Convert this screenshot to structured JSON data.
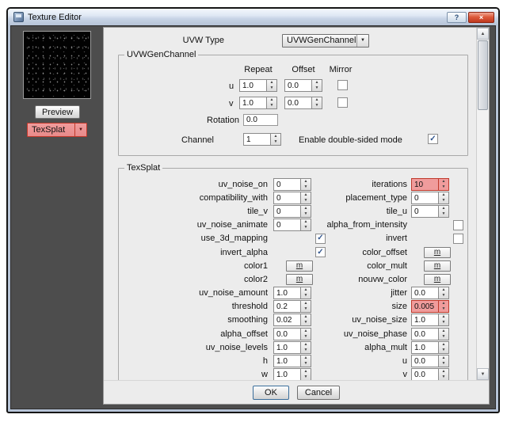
{
  "window": {
    "title": "Texture Editor"
  },
  "icons": {
    "help": "?",
    "close": "×",
    "dropdown": "▼",
    "spin_up": "▲",
    "spin_down": "▼",
    "check": "✓",
    "scroll_up": "▲",
    "scroll_down": "▼"
  },
  "colors": {
    "highlight_bg": "#f09c9c",
    "highlight_border": "#c0392b"
  },
  "left_panel": {
    "preview_button": "Preview",
    "texture_dropdown": {
      "value": "TexSplat",
      "highlighted": true
    }
  },
  "main": {
    "uvw_type": {
      "label": "UVW Type",
      "value": "UVWGenChannel"
    }
  },
  "uvwgen_group": {
    "title": "UVWGenChannel",
    "col_headers": [
      "Repeat",
      "Offset",
      "Mirror"
    ],
    "rows": [
      {
        "label": "u",
        "repeat": "1.0",
        "offset": "0.0",
        "mirror": false
      },
      {
        "label": "v",
        "repeat": "1.0",
        "offset": "0.0",
        "mirror": false
      }
    ],
    "rotation": {
      "label": "Rotation",
      "value": "0.0"
    },
    "channel": {
      "label": "Channel",
      "value": "1",
      "checkbox_label": "Enable double-sided mode",
      "checked": true
    }
  },
  "texsplat_group": {
    "title": "TexSplat",
    "left_rows": [
      {
        "label": "uv_noise_on",
        "type": "spin",
        "value": "0"
      },
      {
        "label": "compatibility_with",
        "type": "spin",
        "value": "0"
      },
      {
        "label": "tile_v",
        "type": "spin",
        "value": "0"
      },
      {
        "label": "uv_noise_animate",
        "type": "spin",
        "value": "0"
      },
      {
        "label": "use_3d_mapping",
        "type": "check",
        "checked": true
      },
      {
        "label": "invert_alpha",
        "type": "check",
        "checked": true
      },
      {
        "label": "color1",
        "type": "map",
        "value": "m"
      },
      {
        "label": "color2",
        "type": "map",
        "value": "m"
      },
      {
        "label": "uv_noise_amount",
        "type": "spin",
        "value": "1.0"
      },
      {
        "label": "threshold",
        "type": "spin",
        "value": "0.2"
      },
      {
        "label": "smoothing",
        "type": "spin",
        "value": "0.02"
      },
      {
        "label": "alpha_offset",
        "type": "spin",
        "value": "0.0"
      },
      {
        "label": "uv_noise_levels",
        "type": "spin",
        "value": "1.0"
      },
      {
        "label": "h",
        "type": "spin",
        "value": "1.0"
      },
      {
        "label": "w",
        "type": "spin",
        "value": "1.0"
      }
    ],
    "right_rows": [
      {
        "label": "iterations",
        "type": "spin",
        "value": "10",
        "highlight": true
      },
      {
        "label": "placement_type",
        "type": "spin",
        "value": "0"
      },
      {
        "label": "tile_u",
        "type": "spin",
        "value": "0"
      },
      {
        "label": "alpha_from_intensity",
        "type": "check",
        "checked": false
      },
      {
        "label": "invert",
        "type": "check",
        "checked": false
      },
      {
        "label": "color_offset",
        "type": "map",
        "value": "m"
      },
      {
        "label": "color_mult",
        "type": "map",
        "value": "m"
      },
      {
        "label": "nouvw_color",
        "type": "map",
        "value": "m"
      },
      {
        "label": "jitter",
        "type": "spin",
        "value": "0.0"
      },
      {
        "label": "size",
        "type": "spin",
        "value": "0.005",
        "highlight": true
      },
      {
        "label": "uv_noise_size",
        "type": "spin",
        "value": "1.0"
      },
      {
        "label": "uv_noise_phase",
        "type": "spin",
        "value": "0.0"
      },
      {
        "label": "alpha_mult",
        "type": "spin",
        "value": "1.0"
      },
      {
        "label": "u",
        "type": "spin",
        "value": "0.0"
      },
      {
        "label": "v",
        "type": "spin",
        "value": "0.0"
      }
    ]
  },
  "footer": {
    "ok_label": "OK",
    "cancel_label": "Cancel"
  }
}
